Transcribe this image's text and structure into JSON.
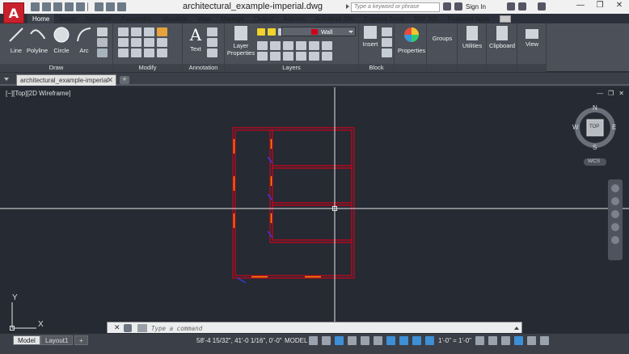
{
  "app": {
    "logo_letter": "A",
    "title": "architectural_example-imperial.dwg",
    "search_placeholder": "Type a keyword or phrase",
    "sign_in": "Sign In",
    "window_controls": [
      "—",
      "❐",
      "✕"
    ]
  },
  "ribbon_tabs": [
    "Home",
    "Insert",
    "Annotate",
    "Parametric",
    "Visualize",
    "View",
    "Manage",
    "Output",
    "Add-ins",
    "Autodesk 360",
    "Express Tools",
    "BIM 360",
    "Featured Apps"
  ],
  "active_tab": "Home",
  "draw_panel": {
    "title": "Draw",
    "tools": [
      "Line",
      "Polyline",
      "Circle",
      "Arc"
    ]
  },
  "modify_panel": {
    "title": "Modify"
  },
  "annotation_panel": {
    "title": "Annotation",
    "text_label": "Text"
  },
  "layers_panel": {
    "title": "Layers",
    "layer_properties_label": "Layer Properties",
    "current_layer": "Wall",
    "current_layer_color": "#d0021b"
  },
  "block_panel": {
    "title": "Block",
    "insert_label": "Insert"
  },
  "right_tools": [
    "Properties",
    "Groups",
    "Utilities",
    "Clipboard",
    "View"
  ],
  "document_tab": {
    "name": "architectural_example-imperial",
    "close": "✕",
    "new": "+"
  },
  "viewport": {
    "label": "[−][Top][2D Wireframe]",
    "controls": [
      "—",
      "❐",
      "✕"
    ]
  },
  "viewcube": {
    "north": "N",
    "south": "S",
    "east": "E",
    "west": "W",
    "face": "TOP",
    "wcs": "WCS"
  },
  "ucs": {
    "x": "X",
    "y": "Y"
  },
  "command_line": {
    "placeholder": "Type a command",
    "close": "✕"
  },
  "status": {
    "layout_tabs": [
      "Model",
      "Layout1"
    ],
    "add_layout": "+",
    "coordinates": "58'-4 15/32\", 41'-0 1/16\", 0'-0\"",
    "space": "MODEL",
    "scale": "1'-0\" = 1'-0\""
  },
  "colors": {
    "canvas": "#252a33",
    "wall": "#d0021b",
    "door": "#ff8c00",
    "door_swing": "#3b3bff",
    "crosshair": "#e6e6e6"
  }
}
